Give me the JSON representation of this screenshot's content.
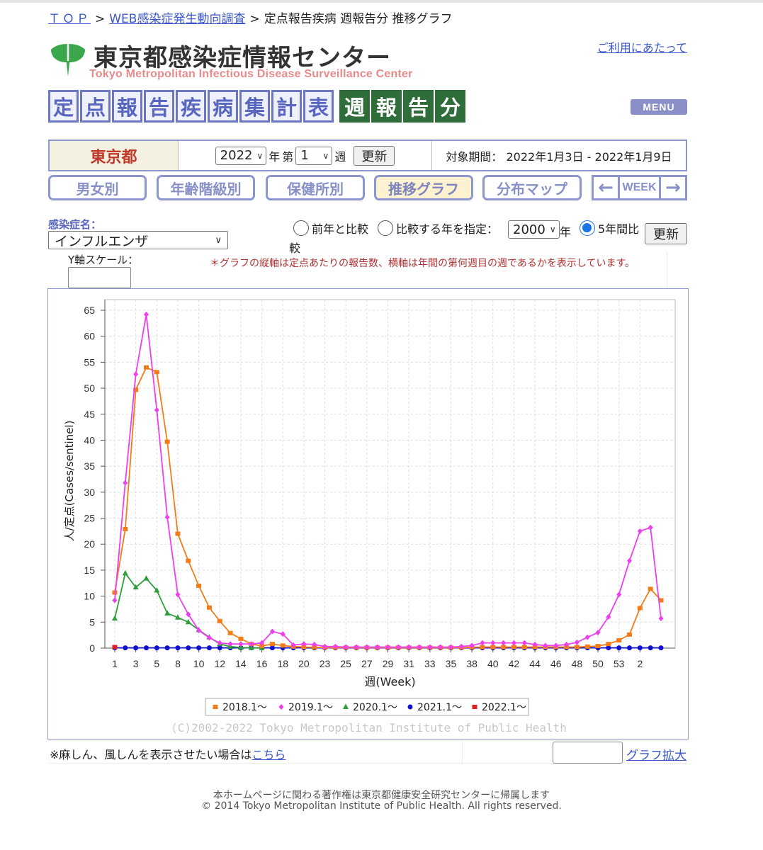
{
  "breadcrumb": {
    "top": "ＴＯＰ",
    "sep1": ">",
    "survey": "WEB感染症発生動向調査",
    "sep2": ">",
    "current": "定点報告疾病 週報告分 推移グラフ"
  },
  "header": {
    "usage_link": "ご利用にあたって",
    "site_title": "東京都感染症情報センター",
    "site_subtitle": "Tokyo Metropolitan Infectious Disease Surveillance Center",
    "banner_tiles": [
      "定",
      "点",
      "報",
      "告",
      "疾",
      "病",
      "集",
      "計",
      "表"
    ],
    "banner_week_tiles": [
      "週",
      "報",
      "告",
      "分"
    ],
    "menu_label": "MENU"
  },
  "info": {
    "prefecture": "東京都",
    "year_value": "2022",
    "year_suffix": "年",
    "week_prefix": "第",
    "week_value": "1",
    "week_suffix": "週",
    "update_button": "更新",
    "period_label": "対象期間：",
    "period_value": "2022年1月3日 - 2022年1月9日"
  },
  "tabs": [
    {
      "label": "男女別",
      "active": false
    },
    {
      "label": "年齢階級別",
      "active": false
    },
    {
      "label": "保健所別",
      "active": false
    },
    {
      "label": "推移グラフ",
      "active": true
    },
    {
      "label": "分布マップ",
      "active": false
    }
  ],
  "week_nav": {
    "label": "WEEK",
    "prev": "←",
    "next": "→"
  },
  "options": {
    "disease_label": "感染症名：",
    "disease_value": "インフルエンザ",
    "compare_prev": "前年と比較",
    "compare_year": "比較する年を指定：",
    "compare_year_value": "2000",
    "compare_year_suffix": "年",
    "five_year_part1": "5年間比",
    "five_year_part2": "較",
    "update_button": "更新",
    "yscale_label": "Y軸スケール：",
    "note": "＊グラフの縦軸は定点あたりの報告数、横軸は年間の第何週目の週であるかを表示しています。"
  },
  "colors": {
    "s2018": "#f07d1a",
    "s2019": "#ee3ef0",
    "s2020": "#2f9e3a",
    "s2021": "#1010d0",
    "s2022": "#e02020",
    "accent": "#8e96cf",
    "banner_green": "#2f6e3a"
  },
  "chart_data": {
    "type": "line",
    "xlabel": "週(Week)",
    "ylabel": "人/定点(Cases/sentinel)",
    "ylim": [
      0,
      65
    ],
    "yticks": [
      0,
      5,
      10,
      15,
      20,
      25,
      30,
      35,
      40,
      45,
      50,
      55,
      60,
      65
    ],
    "x_tick_labels": [
      "1",
      "3",
      "5",
      "8",
      "10",
      "12",
      "14",
      "16",
      "18",
      "20",
      "23",
      "25",
      "27",
      "29",
      "31",
      "33",
      "35",
      "38",
      "40",
      "42",
      "44",
      "46",
      "48",
      "50",
      "53",
      "2"
    ],
    "x_tick_weeks": [
      1,
      3,
      5,
      7,
      9,
      11,
      13,
      15,
      17,
      19,
      21,
      23,
      25,
      27,
      29,
      31,
      33,
      35,
      37,
      39,
      41,
      43,
      45,
      47,
      49,
      51
    ],
    "grid": true,
    "legend_position": "bottom",
    "copyright": "(C)2002-2022 Tokyo Metropolitan Institute of Public Health",
    "series": [
      {
        "name": "2018.1〜",
        "color": "#f07d1a",
        "marker": "square",
        "values": [
          10.7,
          22.9,
          49.7,
          54.0,
          53.1,
          39.7,
          22.0,
          16.8,
          12.0,
          7.8,
          5.2,
          2.9,
          1.8,
          0.8,
          0.4,
          0.8,
          0.5,
          0.3,
          0.2,
          0.15,
          0.1,
          0.1,
          0.1,
          0.1,
          0.1,
          0.1,
          0.1,
          0.1,
          0.1,
          0.1,
          0.1,
          0.1,
          0.1,
          0.1,
          0.15,
          0.2,
          0.2,
          0.2,
          0.2,
          0.2,
          0.2,
          0.2,
          0.2,
          0.2,
          0.2,
          0.3,
          0.4,
          0.8,
          1.5,
          2.6,
          7.7,
          11.4,
          9.2
        ]
      },
      {
        "name": "2019.1〜",
        "color": "#ee3ef0",
        "marker": "diamond",
        "values": [
          9.2,
          31.8,
          52.7,
          64.2,
          45.8,
          25.2,
          10.3,
          6.5,
          3.4,
          2.0,
          1.0,
          0.8,
          0.8,
          0.8,
          1.0,
          3.2,
          2.7,
          0.6,
          0.8,
          0.7,
          0.3,
          0.3,
          0.2,
          0.2,
          0.2,
          0.2,
          0.2,
          0.2,
          0.2,
          0.2,
          0.2,
          0.2,
          0.2,
          0.3,
          0.5,
          1.0,
          1.0,
          1.0,
          1.0,
          1.0,
          0.7,
          0.5,
          0.5,
          0.7,
          1.1,
          2.1,
          3.0,
          6.0,
          10.3,
          16.8,
          22.5,
          23.2,
          5.7
        ]
      },
      {
        "name": "2020.1〜",
        "color": "#2f9e3a",
        "marker": "triangle",
        "values": [
          5.7,
          14.4,
          11.7,
          13.4,
          11.1,
          6.7,
          5.9,
          5.0,
          3.5,
          2.1,
          0.8,
          0.3,
          0.1,
          0.05,
          0.02
        ]
      },
      {
        "name": "2021.1〜",
        "color": "#1010d0",
        "marker": "circle",
        "values": [
          0.05,
          0.05,
          0.05,
          0.05,
          0.05,
          0.05,
          0.05,
          0.05,
          0.05,
          0.05,
          0.05,
          0.05,
          0.05,
          0.05,
          0.05,
          0.05,
          0.05,
          0.05,
          0.05,
          0.05,
          0.05,
          0.05,
          0.05,
          0.05,
          0.05,
          0.05,
          0.05,
          0.05,
          0.05,
          0.05,
          0.05,
          0.05,
          0.05,
          0.05,
          0.05,
          0.05,
          0.05,
          0.05,
          0.05,
          0.05,
          0.05,
          0.05,
          0.05,
          0.05,
          0.05,
          0.05,
          0.05,
          0.05,
          0.05,
          0.05,
          0.05,
          0.05,
          0.05
        ]
      },
      {
        "name": "2022.1〜",
        "color": "#e02020",
        "marker": "square",
        "values": [
          0.2
        ]
      }
    ]
  },
  "bottom": {
    "measles_text": "※麻しん、風しんを表示させたい場合は",
    "measles_link": "こちら",
    "zoom_link": "グラフ拡大"
  },
  "footer": {
    "line1": "本ホームページに関わる著作権は東京都健康安全研究センターに帰属します",
    "line2": "© 2014 Tokyo Metropolitan Institute of Public Health. All rights reserved."
  }
}
